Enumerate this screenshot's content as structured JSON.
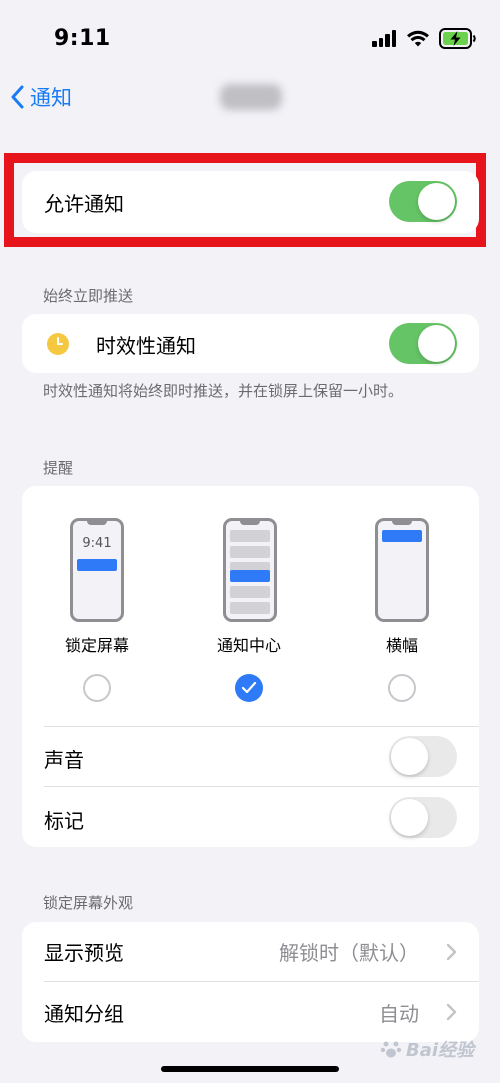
{
  "status_bar": {
    "time": "9:11"
  },
  "nav": {
    "back_label": "通知"
  },
  "allow": {
    "label": "允许通知",
    "enabled": true
  },
  "immediate": {
    "header": "始终立即推送",
    "label": "时效性通知",
    "enabled": true,
    "footnote": "时效性通知将始终即时推送，并在锁屏上保留一小时。"
  },
  "alerts": {
    "header": "提醒",
    "styles": [
      {
        "label": "锁定屏幕",
        "selected": false,
        "preview_time": "9:41"
      },
      {
        "label": "通知中心",
        "selected": true
      },
      {
        "label": "横幅",
        "selected": false
      }
    ],
    "sound": {
      "label": "声音",
      "enabled": false
    },
    "badge": {
      "label": "标记",
      "enabled": false
    }
  },
  "lock_screen": {
    "header": "锁定屏幕外观",
    "show_previews": {
      "label": "显示预览",
      "value": "解锁时（默认）"
    },
    "grouping": {
      "label": "通知分组",
      "value": "自动"
    }
  },
  "watermark": {
    "text": "Bai经验"
  },
  "colors": {
    "accent": "#1a7cf5",
    "toggle_on": "#65c466",
    "highlight": "#e8141b",
    "check_blue": "#2f7af6"
  }
}
